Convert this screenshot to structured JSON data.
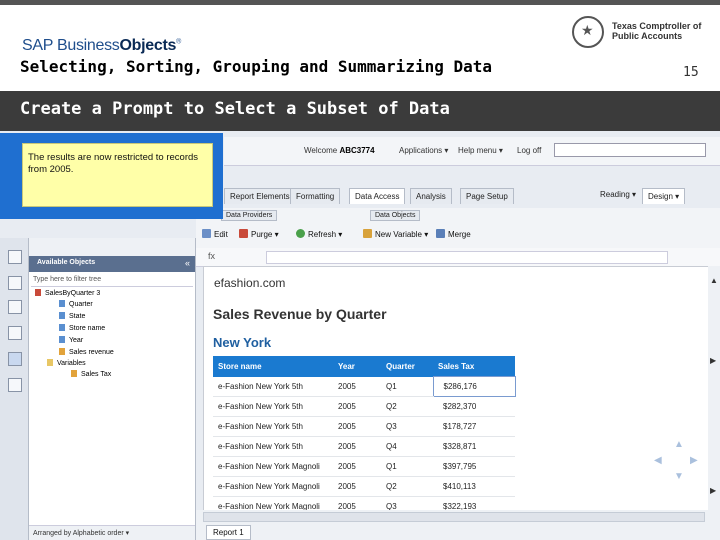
{
  "header": {
    "brand_logo": "SAP BusinessObjects",
    "slide_title": "Selecting, Sorting, Grouping and Summarizing Data",
    "agency_line1": "Texas Comptroller of",
    "agency_line2": "Public Accounts",
    "page_number": "15",
    "subtitle": "Create a Prompt to Select a Subset of Data"
  },
  "callout": {
    "text": "The results are now restricted to records from 2005."
  },
  "app": {
    "welcome_label": "Welcome",
    "user": "ABC3774",
    "applications": "Applications ▾",
    "help": "Help menu ▾",
    "logoff": "Log off",
    "tabs": [
      "Report Elements",
      "Formatting",
      "Data Access",
      "Analysis",
      "Page Setup"
    ],
    "reading": "Reading ▾",
    "design": "Design ▾",
    "ribbon_left_label": "Data Providers",
    "ribbon_right_label": "Data Objects",
    "ribbon_buttons": {
      "edit": "Edit",
      "purge": "Purge ▾",
      "refresh": "Refresh ▾",
      "new_variable": "New Variable ▾",
      "merge": "Merge"
    },
    "formula_fx": "fx",
    "side": {
      "title": "Available Objects",
      "collapse": "«",
      "filter_placeholder": "Type here to filter tree",
      "footer": "Arranged by Alphabetic order ▾",
      "tree": [
        "SalesByQuarter 3",
        "Quarter",
        "State",
        "Store name",
        "Year",
        "Sales revenue",
        "Variables",
        "Sales Tax"
      ]
    },
    "report": {
      "source": "efashion.com",
      "title": "Sales Revenue by Quarter",
      "region": "New York",
      "columns": [
        "Store name",
        "Year",
        "Quarter",
        "Sales Tax"
      ],
      "rows": [
        [
          "e-Fashion New York 5th",
          "2005",
          "Q1",
          "$286,176"
        ],
        [
          "e-Fashion New York 5th",
          "2005",
          "Q2",
          "$282,370"
        ],
        [
          "e-Fashion New York 5th",
          "2005",
          "Q3",
          "$178,727"
        ],
        [
          "e-Fashion New York 5th",
          "2005",
          "Q4",
          "$328,871"
        ],
        [
          "e-Fashion New York Magnoli",
          "2005",
          "Q1",
          "$397,795"
        ],
        [
          "e-Fashion New York Magnoli",
          "2005",
          "Q2",
          "$410,113"
        ],
        [
          "e-Fashion New York Magnoli",
          "2005",
          "Q3",
          "$322,193"
        ]
      ]
    },
    "report_tab": "Report 1"
  }
}
